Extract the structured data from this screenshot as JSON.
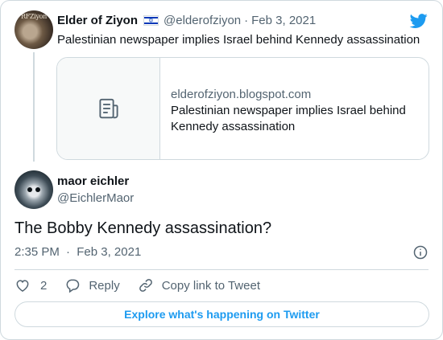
{
  "parent_tweet": {
    "author_name": "Elder of Ziyon",
    "flag_icon": "israel-flag-icon",
    "handle": "@elderofziyon",
    "separator": "·",
    "date": "Feb 3, 2021",
    "text": "Palestinian newspaper implies Israel behind Kennedy assassination",
    "avatar_logo_text": "RFZiyon",
    "link_card": {
      "domain": "elderofziyon.blogspot.com",
      "title": "Palestinian newspaper implies Israel behind Kennedy assassination",
      "thumbnail_icon": "document-icon"
    }
  },
  "reply_tweet": {
    "author_name": "maor eichler",
    "handle": "@EichlerMaor",
    "text": "The Bobby Kennedy assassination?",
    "time": "2:35 PM",
    "separator": "·",
    "date": "Feb 3, 2021"
  },
  "actions": {
    "like_count": "2",
    "reply_label": "Reply",
    "copy_link_label": "Copy link to Tweet"
  },
  "explore_button": {
    "label": "Explore what's happening on Twitter"
  },
  "colors": {
    "accent": "#1d9bf0",
    "secondary_text": "#536471",
    "border": "#cfd9de"
  }
}
